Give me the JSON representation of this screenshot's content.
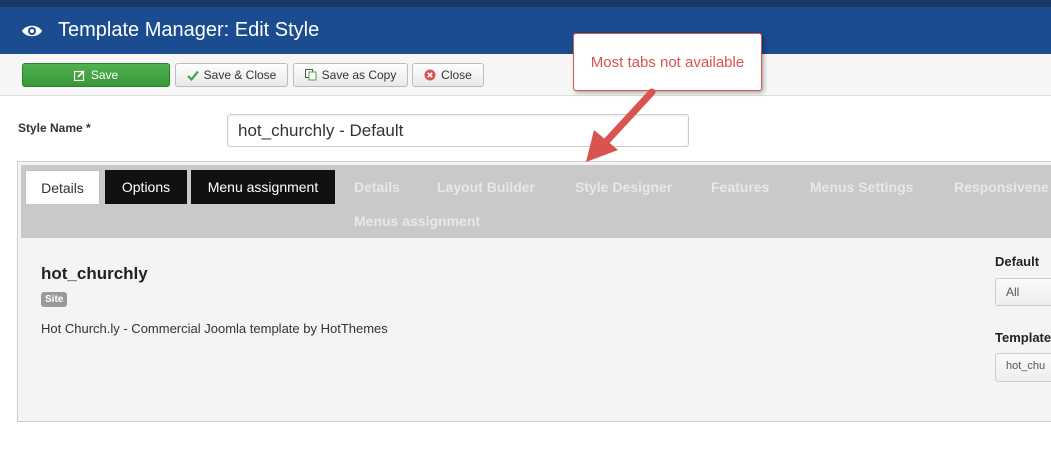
{
  "header": {
    "title": "Template Manager: Edit Style",
    "icon": "eye-icon"
  },
  "toolbar": {
    "save_label": "Save",
    "save_close_label": "Save & Close",
    "save_copy_label": "Save as Copy",
    "close_label": "Close"
  },
  "style_name": {
    "label": "Style Name *",
    "value": "hot_churchly - Default"
  },
  "tabs": {
    "active": [
      "Details",
      "Options",
      "Menu assignment"
    ],
    "disabled": [
      "Details",
      "Layout Builder",
      "Style Designer",
      "Features",
      "Menus Settings",
      "Responsivene",
      "Menus assignment"
    ]
  },
  "template": {
    "name": "hot_churchly",
    "badge": "Site",
    "description": "Hot Church.ly - Commercial Joomla template by HotThemes"
  },
  "side": {
    "default_label": "Default",
    "default_value": "All",
    "template_label": "Template",
    "template_value": "hot_chu"
  },
  "callout": {
    "text": "Most tabs not available"
  },
  "colors": {
    "header": "#1a4c8f",
    "save_button": "#46a546",
    "callout": "#d9534f"
  }
}
